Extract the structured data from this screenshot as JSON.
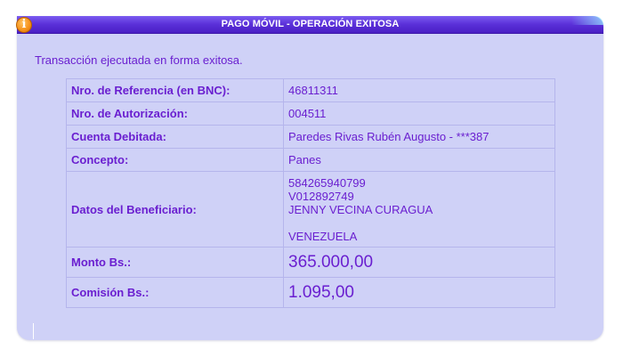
{
  "window": {
    "title": "PAGO MÓVIL - OPERACIÓN EXITOSA",
    "icon": "info-icon"
  },
  "message": "Transacción ejecutada en forma exitosa.",
  "details": {
    "reference": {
      "label": "Nro. de Referencia (en BNC):",
      "value": "46811311"
    },
    "authorization": {
      "label": "Nro. de Autorización:",
      "value": "004511"
    },
    "debited_account": {
      "label": "Cuenta Debitada:",
      "value": "Paredes Rivas Rubén Augusto - ***387"
    },
    "concept": {
      "label": "Concepto:",
      "value": "Panes"
    },
    "beneficiary": {
      "label": "Datos del Beneficiario:",
      "phone": "584265940799",
      "id": "V012892749",
      "name": "JENNY VECINA CURAGUA",
      "country": "VENEZUELA"
    },
    "amount": {
      "label": "Monto Bs.:",
      "value": "365.000,00"
    },
    "commission": {
      "label": "Comisión Bs.:",
      "value": "1.095,00"
    }
  },
  "colors": {
    "panel_background": "#cfd1f7",
    "title_bar": "#5a2fd8",
    "text": "#6a1fd0",
    "table_border": "#b5b5ec",
    "icon": "#f7941d"
  }
}
